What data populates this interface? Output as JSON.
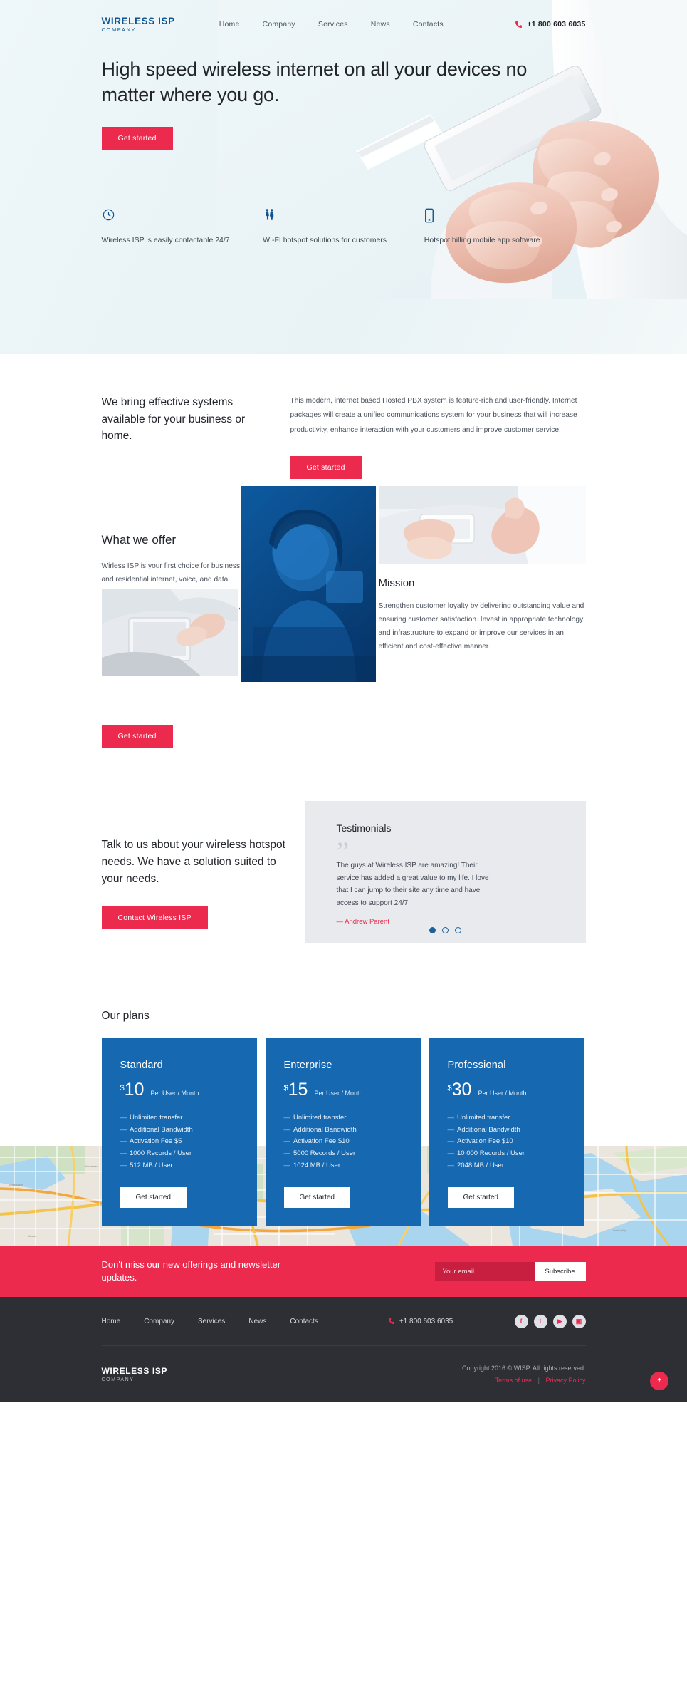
{
  "header": {
    "logo_main": "WIRELESS ISP",
    "logo_sub": "COMPANY",
    "nav": [
      {
        "label": "Home"
      },
      {
        "label": "Company"
      },
      {
        "label": "Services"
      },
      {
        "label": "News"
      },
      {
        "label": "Contacts"
      }
    ],
    "phone": "+1 800 603 6035",
    "phone_icon": "phone-icon"
  },
  "hero": {
    "title": "High speed wireless internet on all your devices no matter where you go.",
    "cta": "Get started",
    "features": [
      {
        "icon": "clock-icon",
        "text": "Wireless ISP is easily contactable 24/7"
      },
      {
        "icon": "people-icon",
        "text": "WI-FI hotspot solutions for customers"
      },
      {
        "icon": "mobile-icon",
        "text": "Hotspot billing mobile app software"
      }
    ]
  },
  "systems": {
    "heading": "We bring effective systems available for your business or home.",
    "body": "This modern, internet based Hosted PBX system is feature-rich and user-friendly. Internet packages will create a unified communications system for your business that will increase productivity, enhance interaction with your customers and improve customer service.",
    "cta": "Get started"
  },
  "offer": {
    "heading": "What we offer",
    "body": "Wirless ISP is your first choice for business and residential internet, voice, and data services in South Central Texas including Seguin, Karnes City, Kenedy, Three Rivers, and George West.",
    "mission_heading": "Mission",
    "mission_body": "Strengthen customer loyalty by delivering outstanding value and ensuring customer satisfaction. Invest in appropriate technology and infrastructure to expand or improve our services in an efficient and cost-effective manner.",
    "cta": "Get started"
  },
  "talk": {
    "heading": "Talk to us about your wireless hotspot needs. We have a solution suited to your needs.",
    "cta": "Contact Wireless ISP"
  },
  "testimonials": {
    "heading": "Testimonials",
    "quote_mark": "”",
    "quote": "The guys at Wireless ISP are amazing! Their service has added a great value to my life. I love that I can jump to their site any time and have access to support 24/7.",
    "author": "— Andrew Parent",
    "dots": [
      true,
      false,
      false
    ]
  },
  "plans": {
    "heading": "Our plans",
    "items": [
      {
        "name": "Standard",
        "currency": "$",
        "amount": "10",
        "period": "Per User / Month",
        "features": [
          "Unlimited transfer",
          "Additional Bandwidth",
          "Activation Fee $5",
          "1000 Records / User",
          "512 MB / User"
        ],
        "cta": "Get started"
      },
      {
        "name": "Enterprise",
        "currency": "$",
        "amount": "15",
        "period": "Per User / Month",
        "features": [
          "Unlimited transfer",
          "Additional Bandwidth",
          "Activation Fee $10",
          "5000 Records / User",
          "1024 MB / User"
        ],
        "cta": "Get started"
      },
      {
        "name": "Professional",
        "currency": "$",
        "amount": "30",
        "period": "Per User / Month",
        "features": [
          "Unlimited transfer",
          "Additional Bandwidth",
          "Activation Fee $10",
          "10 000 Records / User",
          "2048 MB / User"
        ],
        "cta": "Get started"
      }
    ]
  },
  "newsletter": {
    "heading": "Don't miss our new offerings and newsletter updates.",
    "placeholder": "Your email",
    "value": "",
    "button": "Subscribe"
  },
  "footer": {
    "nav": [
      {
        "label": "Home"
      },
      {
        "label": "Company"
      },
      {
        "label": "Services"
      },
      {
        "label": "News"
      },
      {
        "label": "Contacts"
      }
    ],
    "phone": "+1 800 603 6035",
    "socials": [
      {
        "name": "facebook-icon",
        "glyph": "f"
      },
      {
        "name": "twitter-icon",
        "glyph": "t"
      },
      {
        "name": "youtube-icon",
        "glyph": "▶"
      },
      {
        "name": "instagram-icon",
        "glyph": "▣"
      }
    ],
    "logo_main": "WIRELESS ISP",
    "logo_sub": "COMPANY",
    "copyright": "Copyright 2016 © WISP. All rights reserved.",
    "terms": "Terms of use",
    "separator": "|",
    "privacy": "Privacy Policy",
    "to_top_icon": "arrow-up-icon"
  },
  "colors": {
    "accent_red": "#ec2a4e",
    "brand_blue": "#1668b0",
    "logo_blue": "#10558f",
    "footer_dark": "#2d2f34",
    "testimonial_bg": "#e9eaee"
  }
}
